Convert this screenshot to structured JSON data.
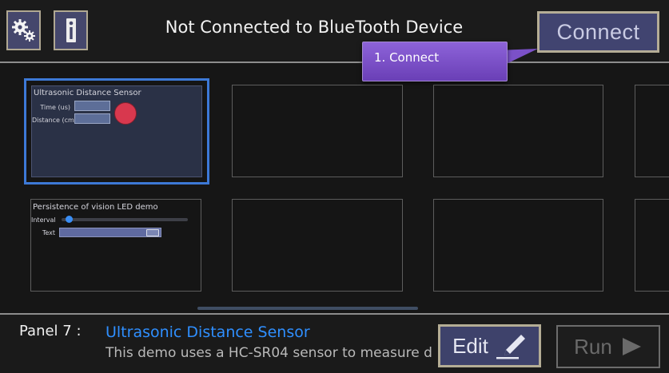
{
  "header": {
    "title": "Not Connected to BlueTooth Device",
    "settings_icon": "gears-icon",
    "info_icon": "info-icon",
    "connect_label": "Connect"
  },
  "tooltip": {
    "text": "1.  Connect"
  },
  "panels": [
    {
      "title": "Ultrasonic Distance Sensor",
      "fields": [
        {
          "label": "Time (us)"
        },
        {
          "label": "Distance (cm)"
        }
      ],
      "indicator_color": "#d8384e"
    },
    {
      "title": "Persistence of vision LED demo",
      "interval_label": "Interval",
      "text_label": "Text"
    }
  ],
  "footer": {
    "panel_label": "Panel 7 :",
    "panel_name": "Ultrasonic Distance Sensor",
    "description": "This demo uses a HC-SR04 sensor to measure d",
    "edit_label": "Edit",
    "run_label": "Run"
  },
  "colors": {
    "accent": "#2f8fff",
    "selected_border": "#3d79d7",
    "button_bg": "#414470",
    "button_border": "#b5ad96",
    "tooltip": "#7b51c8"
  }
}
